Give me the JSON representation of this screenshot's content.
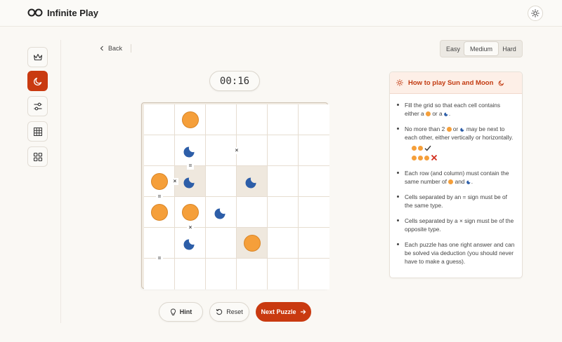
{
  "app": {
    "title": "Infinite Play"
  },
  "nav": {
    "back_label": "Back"
  },
  "difficulty": {
    "options": [
      "Easy",
      "Medium",
      "Hard"
    ],
    "selected": "Medium"
  },
  "timer": "00:16",
  "sidebar": {
    "items": [
      {
        "icon": "crown-icon",
        "active": false
      },
      {
        "icon": "moon-icon",
        "active": true
      },
      {
        "icon": "sliders-icon",
        "active": false
      },
      {
        "icon": "grid-icon",
        "active": false
      },
      {
        "icon": "apps-grid-icon",
        "active": false
      }
    ]
  },
  "board": {
    "rows": 6,
    "cols": 6,
    "cells": [
      [
        "",
        "sun",
        "",
        "",
        "",
        ""
      ],
      [
        "",
        "moon",
        "",
        "",
        "",
        ""
      ],
      [
        "sun",
        "moon",
        "",
        "moon",
        "",
        ""
      ],
      [
        "sun",
        "sun",
        "moon",
        "",
        "",
        ""
      ],
      [
        "",
        "moon",
        "",
        "sun",
        "",
        ""
      ],
      [
        "",
        "",
        "",
        "",
        "",
        ""
      ]
    ],
    "locked": [
      [
        2,
        1
      ],
      [
        2,
        3
      ],
      [
        4,
        3
      ]
    ],
    "constraints": [
      {
        "symbol": "×",
        "between": [
          [
            1,
            2
          ],
          [
            1,
            3
          ]
        ]
      },
      {
        "symbol": "=",
        "between": [
          [
            1,
            1
          ],
          [
            2,
            1
          ]
        ]
      },
      {
        "symbol": "×",
        "between": [
          [
            2,
            0
          ],
          [
            2,
            1
          ]
        ]
      },
      {
        "symbol": "=",
        "between": [
          [
            2,
            0
          ],
          [
            3,
            0
          ]
        ]
      },
      {
        "symbol": "×",
        "between": [
          [
            3,
            1
          ],
          [
            4,
            1
          ]
        ]
      },
      {
        "symbol": "=",
        "between": [
          [
            4,
            0
          ],
          [
            5,
            0
          ]
        ]
      }
    ]
  },
  "actions": {
    "hint_label": "Hint",
    "reset_label": "Reset",
    "next_label": "Next Puzzle"
  },
  "help": {
    "title": "How to play Sun and Moon",
    "rule1_a": "Fill the grid so that each cell contains either a",
    "rule1_or": "or a",
    "rule1_end": ".",
    "rule2_a": "No more than 2",
    "rule2_or": "or",
    "rule2_b": "may be next to each other, either vertically or horizontally.",
    "rule3_a": "Each row (and column) must contain the same number of",
    "rule3_and": "and",
    "rule3_end": ".",
    "rule4": "Cells separated by an = sign must be of the same type.",
    "rule5": "Cells separated by a × sign must be of the opposite type.",
    "rule6": "Each puzzle has one right answer and can be solved via deduction (you should never have to make a guess)."
  },
  "colors": {
    "accent": "#c93a10",
    "sun": "#f59f3a",
    "moon": "#2d5ea8",
    "locked": "#efe8de"
  }
}
